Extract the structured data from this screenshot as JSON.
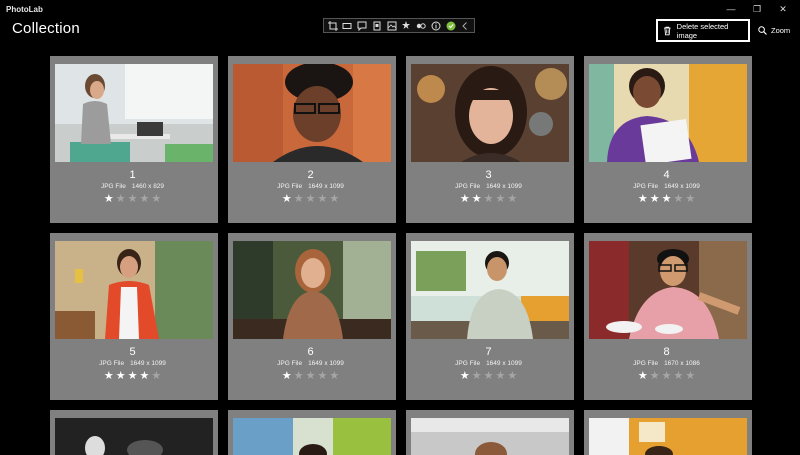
{
  "app": {
    "name": "PhotoLab"
  },
  "header": {
    "title": "Collection",
    "delete_label": "Delete selected image",
    "zoom_label": "Zoom"
  },
  "toolbar_icons": [
    "crop-icon",
    "rectangle-icon",
    "comment-icon",
    "frame-icon",
    "gallery-icon",
    "effects-icon",
    "adjust-icon",
    "info-icon",
    "check-icon",
    "chevron-left-icon"
  ],
  "window_controls": [
    "minimize-icon",
    "restore-icon",
    "close-icon"
  ],
  "photos": [
    {
      "number": "1",
      "type": "JPG File",
      "dims": "1460 x 829",
      "rating": 1,
      "scene": "office-desk"
    },
    {
      "number": "2",
      "type": "JPG File",
      "dims": "1649 x 1099",
      "rating": 1,
      "scene": "young-man-glasses"
    },
    {
      "number": "3",
      "type": "JPG File",
      "dims": "1649 x 1099",
      "rating": 2,
      "scene": "woman-portrait"
    },
    {
      "number": "4",
      "type": "JPG File",
      "dims": "1649 x 1099",
      "rating": 3,
      "scene": "girl-drawing"
    },
    {
      "number": "5",
      "type": "JPG File",
      "dims": "1649 x 1099",
      "rating": 4,
      "scene": "kitchen-woman"
    },
    {
      "number": "6",
      "type": "JPG File",
      "dims": "1649 x 1099",
      "rating": 1,
      "scene": "cafe-woman"
    },
    {
      "number": "7",
      "type": "JPG File",
      "dims": "1649 x 1099",
      "rating": 1,
      "scene": "man-laughing"
    },
    {
      "number": "8",
      "type": "JPG File",
      "dims": "1670 x 1086",
      "rating": 1,
      "scene": "man-pointing"
    }
  ],
  "colors": {
    "background": "#000000",
    "card": "#808080",
    "star_on": "#ffffff",
    "star_off": "#a6a6a6"
  }
}
